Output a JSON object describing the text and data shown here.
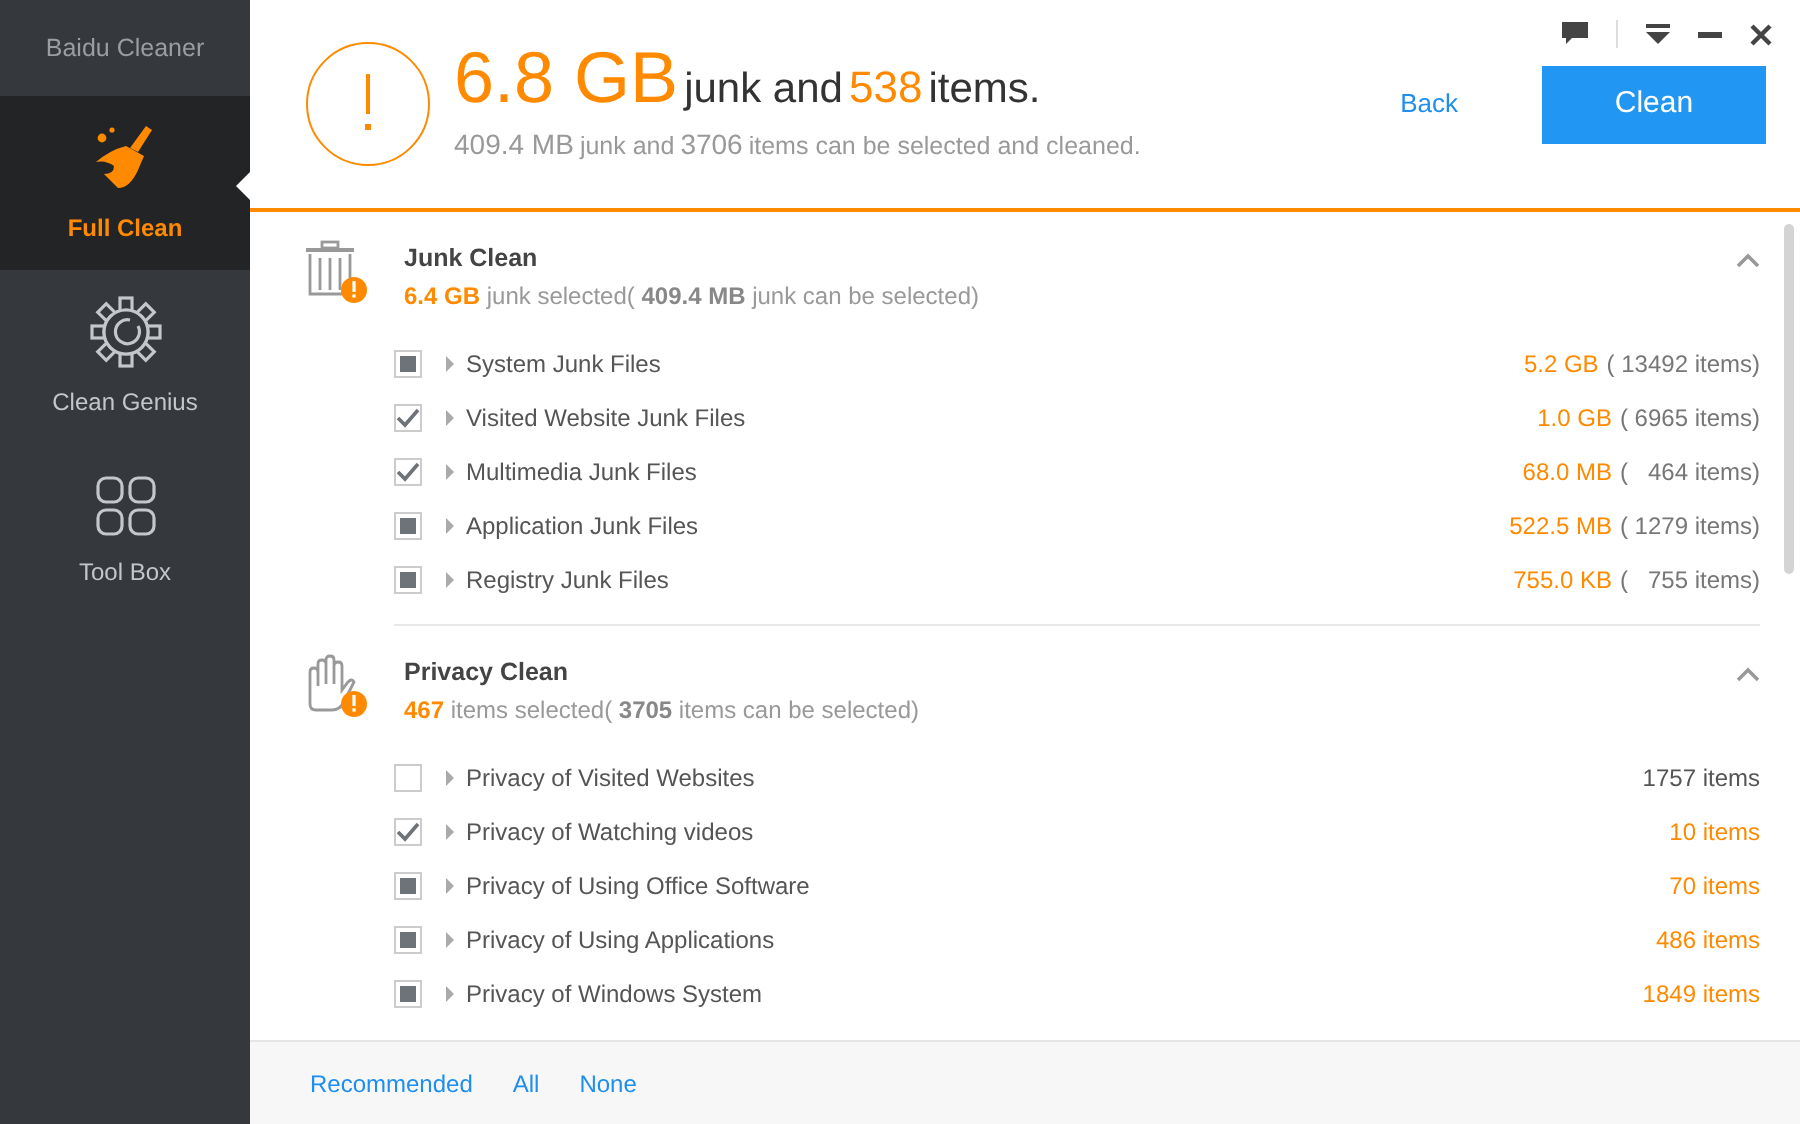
{
  "app_title": "Baidu Cleaner",
  "sidebar": {
    "items": [
      {
        "label": "Full Clean",
        "kind": "broom",
        "selected": true
      },
      {
        "label": "Clean Genius",
        "kind": "gear",
        "selected": false
      },
      {
        "label": "Tool Box",
        "kind": "grid",
        "selected": false
      }
    ]
  },
  "summary": {
    "headline": [
      {
        "text": "6.8 GB",
        "kind": "big"
      },
      {
        "text": "junk and",
        "kind": "plain"
      },
      {
        "text": "538",
        "kind": "number"
      },
      {
        "text": "items.",
        "kind": "plain"
      }
    ],
    "subline": [
      {
        "text": "409.4 MB",
        "kind": "number"
      },
      {
        "text": "junk and",
        "kind": "plain"
      },
      {
        "text": "3706",
        "kind": "number"
      },
      {
        "text": "items can be selected and cleaned.",
        "kind": "plain"
      }
    ]
  },
  "back_link": "Back",
  "clean_button": "Clean",
  "sections": [
    {
      "title": "Junk Clean",
      "kind": "trash",
      "expanded": true,
      "subtitle": [
        {
          "text": "6.4 GB",
          "kind": "highlight"
        },
        {
          "text": "junk selected(",
          "kind": "plain"
        },
        {
          "text": "409.4 MB",
          "kind": "bold"
        },
        {
          "text": "junk can be selected)",
          "kind": "plain"
        }
      ],
      "rows": [
        {
          "label": "System Junk Files",
          "kind": "partial",
          "size": "5.2 GB",
          "count": "( 13492 items)"
        },
        {
          "label": "Visited Website Junk Files",
          "kind": "checked",
          "size": "1.0 GB",
          "count": "( 6965 items)"
        },
        {
          "label": "Multimedia Junk Files",
          "kind": "checked",
          "size": "68.0 MB",
          "count": "(   464 items)"
        },
        {
          "label": "Application Junk Files",
          "kind": "partial",
          "size": "522.5 MB",
          "count": "( 1279 items)"
        },
        {
          "label": "Registry Junk Files",
          "kind": "partial",
          "size": "755.0 KB",
          "count": "(   755 items)"
        }
      ]
    },
    {
      "title": "Privacy Clean",
      "kind": "hand",
      "expanded": true,
      "subtitle": [
        {
          "text": "467",
          "kind": "highlight"
        },
        {
          "text": "items selected(",
          "kind": "plain"
        },
        {
          "text": "3705",
          "kind": "bold"
        },
        {
          "text": "items can be selected)",
          "kind": "plain"
        }
      ],
      "rows": [
        {
          "label": "Privacy of Visited Websites",
          "kind": "unchecked",
          "count": "1757 items"
        },
        {
          "label": "Privacy of Watching videos",
          "kind": "checked",
          "count": "10 items"
        },
        {
          "label": "Privacy of Using Office Software",
          "kind": "partial",
          "count": "70 items"
        },
        {
          "label": "Privacy of Using Applications",
          "kind": "partial",
          "count": "486 items"
        },
        {
          "label": "Privacy of Windows System",
          "kind": "partial",
          "count": "1849 items"
        }
      ]
    }
  ],
  "footer_links": [
    "Recommended",
    "All",
    "None"
  ]
}
